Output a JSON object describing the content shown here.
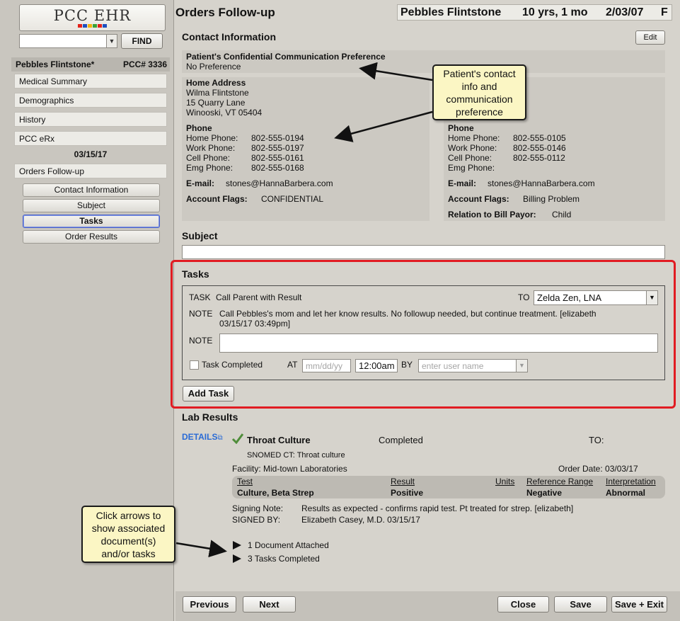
{
  "sidebar": {
    "logo": "PCC EHR",
    "logo_colors": [
      "#e32119",
      "#1e4fbf",
      "#f3b20a",
      "#3aa335",
      "#e32119",
      "#1e4fbf"
    ],
    "find_label": "FIND",
    "patient_name": "Pebbles Flintstone*",
    "pcc_number": "PCC# 3336",
    "nav_items": [
      "Medical Summary",
      "Demographics",
      "History",
      "PCC eRx"
    ],
    "encounter_date": "03/15/17",
    "encounter_item": "Orders Follow-up",
    "sub_items": [
      "Contact Information",
      "Subject",
      "Tasks",
      "Order Results"
    ],
    "active_sub_item": "Tasks"
  },
  "header": {
    "title": "Orders Follow-up",
    "patient_name": "Pebbles Flintstone",
    "age": "10 yrs, 1 mo",
    "dob": "2/03/07",
    "sex": "F"
  },
  "contact": {
    "title": "Contact Information",
    "edit_label": "Edit",
    "pref_label": "Patient's Confidential Communication Preference",
    "pref_value": "No Preference",
    "home_address_label": "Home Address",
    "address_lines": [
      "Wilma Flintstone",
      "15 Quarry Lane",
      "Winooski, VT 05404"
    ],
    "left": {
      "phone_label": "Phone",
      "phones": [
        {
          "label": "Home Phone:",
          "value": "802-555-0194"
        },
        {
          "label": "Work Phone:",
          "value": "802-555-0197"
        },
        {
          "label": "Cell Phone:",
          "value": "802-555-0161"
        },
        {
          "label": "Emg Phone:",
          "value": "802-555-0168"
        }
      ],
      "email_label": "E-mail:",
      "email": "stones@HannaBarbera.com",
      "flags_label": "Account Flags:",
      "flags": "CONFIDENTIAL"
    },
    "right": {
      "phone_label": "Phone",
      "phones": [
        {
          "label": "Home Phone:",
          "value": "802-555-0105"
        },
        {
          "label": "Work Phone:",
          "value": "802-555-0146"
        },
        {
          "label": "Cell Phone:",
          "value": "802-555-0112"
        },
        {
          "label": "Emg Phone:",
          "value": ""
        }
      ],
      "email_label": "E-mail:",
      "email": "stones@HannaBarbera.com",
      "flags_label": "Account Flags:",
      "flags": "Billing Problem",
      "relation_label": "Relation to Bill Payor:",
      "relation": "Child"
    }
  },
  "subject": {
    "title": "Subject",
    "value": ""
  },
  "tasks": {
    "title": "Tasks",
    "task_label": "TASK",
    "task_text": "Call Parent with Result",
    "to_label": "TO",
    "to_value": "Zelda Zen, LNA",
    "note_label": "NOTE",
    "note_line1": "Call Pebbles's mom and let her know results. No followup needed, but continue treatment.  [elizabeth",
    "note_line2": "03/15/17 03:49pm]",
    "note_input_label": "NOTE",
    "task_completed_label": "Task Completed",
    "at_label": "AT",
    "date_placeholder": "mm/dd/yy",
    "time_value": "12:00am",
    "by_label": "BY",
    "user_placeholder": "enter user name",
    "add_task_label": "Add Task"
  },
  "lab": {
    "title": "Lab Results",
    "details_label": "DETAILS",
    "test_name": "Throat Culture",
    "status": "Completed",
    "to_label": "TO:",
    "snomed": "SNOMED CT: Throat culture",
    "facility": "Facility: Mid-town Laboratories",
    "order_date": "Order Date: 03/03/17",
    "columns": [
      "Test",
      "Result",
      "Units",
      "Reference Range",
      "Interpretation"
    ],
    "row": [
      "Culture, Beta Strep",
      "Positive",
      "",
      "Negative",
      "Abnormal"
    ],
    "signing_note_label": "Signing Note:",
    "signing_note": "Results as expected - confirms rapid test. Pt treated for strep. [elizabeth]",
    "signed_by_label": "SIGNED BY:",
    "signed_by": "Elizabeth Casey, M.D. 03/15/17",
    "documents": "1 Document Attached",
    "tasks_completed": "3 Tasks Completed"
  },
  "callouts": {
    "contact": [
      "Patient's contact",
      "info and",
      "communication",
      "preference"
    ],
    "arrows": [
      "Click arrows to",
      "show associated",
      "document(s)",
      "and/or tasks"
    ]
  },
  "footer": {
    "previous": "Previous",
    "next": "Next",
    "close": "Close",
    "save": "Save",
    "save_exit": "Save + Exit"
  }
}
